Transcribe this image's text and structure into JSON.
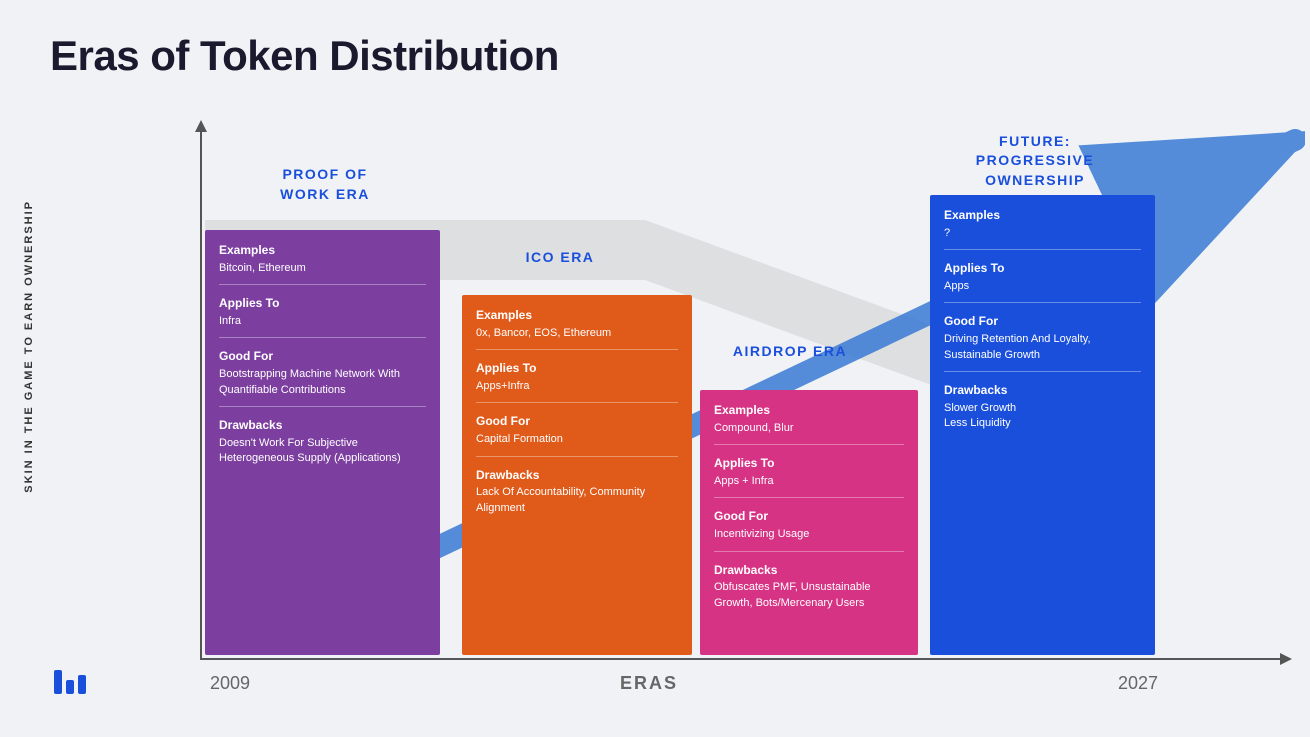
{
  "title": "Eras of Token Distribution",
  "yAxisLabel": "SKIN IN THE GAME TO EARN OWNERSHIP",
  "xAxis": {
    "start": "2009",
    "label": "ERAS",
    "end": "2027"
  },
  "eras": {
    "pow": {
      "title": "PROOF OF\nWORK ERA",
      "examples_label": "Examples",
      "examples_value": "Bitcoin, Ethereum",
      "applies_label": "Applies To",
      "applies_value": "Infra",
      "good_label": "Good For",
      "good_value": "Bootstrapping Machine Network With Quantifiable Contributions",
      "drawbacks_label": "Drawbacks",
      "drawbacks_value": "Doesn't Work For Subjective Heterogeneous Supply (Applications)"
    },
    "ico": {
      "title": "ICO ERA",
      "examples_label": "Examples",
      "examples_value": "0x, Bancor, EOS, Ethereum",
      "applies_label": "Applies To",
      "applies_value": "Apps+Infra",
      "good_label": "Good For",
      "good_value": "Capital Formation",
      "drawbacks_label": "Drawbacks",
      "drawbacks_value": "Lack Of Accountability, Community Alignment"
    },
    "airdrop": {
      "title": "AIRDROP ERA",
      "examples_label": "Examples",
      "examples_value": "Compound, Blur",
      "applies_label": "Applies To",
      "applies_value": "Apps + Infra",
      "good_label": "Good For",
      "good_value": "Incentivizing Usage",
      "drawbacks_label": "Drawbacks",
      "drawbacks_value": "Obfuscates PMF, Unsustainable Growth, Bots/Mercenary Users"
    },
    "future": {
      "title": "FUTURE:\nPROGRESSIVE\nOWNERSHIP",
      "examples_label": "Examples",
      "examples_value": "?",
      "applies_label": "Applies To",
      "applies_value": "Apps",
      "good_label": "Good For",
      "good_value": "Driving Retention And Loyalty, Sustainable Growth",
      "drawbacks_label": "Drawbacks",
      "drawbacks_value": "Slower Growth\nLess Liquidity"
    }
  }
}
